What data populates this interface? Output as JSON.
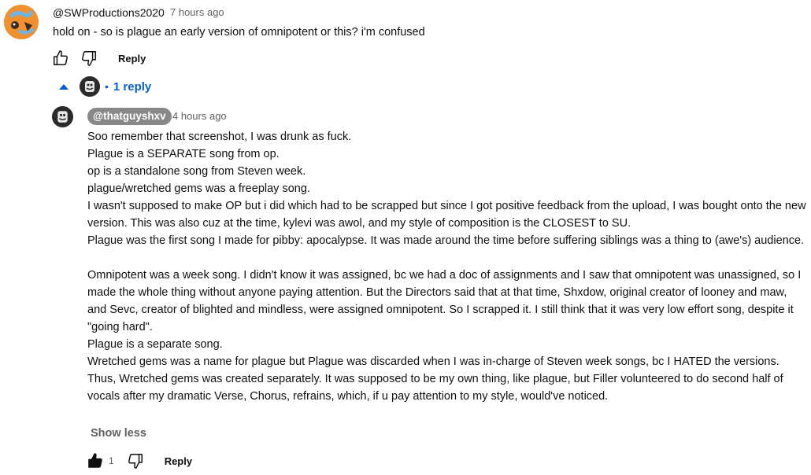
{
  "top_comment": {
    "author": "@SWProductions2020",
    "time": "7 hours ago",
    "text": "hold on - so is plague an early version of omnipotent or this? i'm confused",
    "reply_label": "Reply"
  },
  "replies_toggle": {
    "count_label": "1 reply",
    "separator": "•"
  },
  "reply_comment": {
    "author": "@thatguyshxv",
    "time": "4 hours ago",
    "lines": [
      "Soo remember that screenshot, I was drunk as fuck.",
      "Plague is a SEPARATE song from op.",
      "op is a standalone song from Steven week.",
      "plague/wretched gems was a freeplay song.",
      "I wasn't supposed to make OP but i did which had to be scrapped but since I got positive feedback from the upload, I was bought onto the new version. This was also cuz at the time, kylevi was awol, and my style of composition is the CLOSEST to SU.",
      "Plague was the first song I made for pibby: apocalypse. It was made around the time before suffering siblings was a thing to (awe's) audience.",
      "",
      "Omnipotent was a week song. I didn't know it was assigned, bc we had a doc of assignments and I saw that omnipotent was unassigned, so I made the whole thing without anyone paying attention. But the Directors said that at that time, Shxdow, original creator of looney and maw, and Sevc, creator of blighted and mindless, were assigned omnipotent. So I scrapped it. I still think that it was very low effort song, despite it \"going hard\".",
      "Plague is a separate song.",
      "Wretched gems was a name for plague but Plague was discarded when I was in-charge of Steven week songs, bc I HATED the versions. Thus, Wretched gems was created separately. It was supposed to be my own thing, like plague, but Filler volunteered to do second half of vocals after my dramatic Verse, Chorus, refrains, which, if u pay attention to my style, would've noticed."
    ],
    "show_less_label": "Show less",
    "like_count": "1",
    "reply_label": "Reply"
  },
  "icons": {
    "like": "thumbs-up-icon",
    "dislike": "thumbs-down-icon",
    "collapse": "caret-up-icon"
  },
  "colors": {
    "link_blue": "#065fd4",
    "secondary_text": "#606060",
    "author_badge": "#888888",
    "avatar_orange": "#f0902e"
  }
}
